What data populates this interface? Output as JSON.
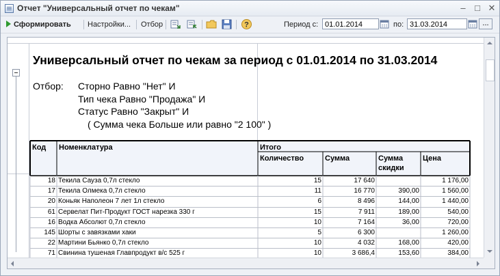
{
  "window": {
    "title": "Отчет \"Универсальный отчет по чекам\"",
    "controls": [
      "–",
      "□",
      "✕"
    ]
  },
  "toolbar": {
    "generate_label": "Сформировать",
    "settings_label": "Настройки...",
    "filter_label": "Отбор",
    "help_label": "?",
    "period_from_label": "Период с:",
    "period_from_value": "01.01.2014",
    "period_to_label": "по:",
    "period_to_value": "31.03.2014",
    "more_label": "..."
  },
  "report": {
    "title": "Универсальный отчет по чекам за период с 01.01.2014 по 31.03.2014",
    "filter_label": "Отбор:",
    "filter_lines": [
      "Сторно Равно \"Нет\" И",
      "Тип чека Равно \"Продажа\" И",
      "Статус Равно \"Закрыт\" И",
      "( Сумма чека Больше или равно \"2 100\" )"
    ],
    "headers": {
      "code": "Код",
      "item": "Номенклатура",
      "total": "Итого",
      "qty": "Количество",
      "sum": "Сумма",
      "discount_line1": "Сумма",
      "discount_line2": "скидки",
      "price": "Цена"
    },
    "rows": [
      {
        "code": "18",
        "item": "Текила Сауза 0,7л стекло",
        "qty": "15",
        "sum": "17 640",
        "discount": "",
        "price": "1 176,00"
      },
      {
        "code": "17",
        "item": "Текила Олмека 0,7л стекло",
        "qty": "11",
        "sum": "16 770",
        "discount": "390,00",
        "price": "1 560,00"
      },
      {
        "code": "20",
        "item": "Коньяк Наполеон 7 лет 1л стекло",
        "qty": "6",
        "sum": "8 496",
        "discount": "144,00",
        "price": "1 440,00"
      },
      {
        "code": "61",
        "item": "Сервелат Пит-Продукт ГОСТ нарезка 330 г",
        "qty": "15",
        "sum": "7 911",
        "discount": "189,00",
        "price": "540,00"
      },
      {
        "code": "16",
        "item": "Водка Абсолют 0,7л стекло",
        "qty": "10",
        "sum": "7 164",
        "discount": "36,00",
        "price": "720,00"
      },
      {
        "code": "145",
        "item": "Шорты с завязками хаки",
        "qty": "5",
        "sum": "6 300",
        "discount": "",
        "price": "1 260,00"
      },
      {
        "code": "22",
        "item": "Мартини Бьянко 0,7л стекло",
        "qty": "10",
        "sum": "4 032",
        "discount": "168,00",
        "price": "420,00"
      },
      {
        "code": "71",
        "item": "Свинина тушеная Главпродукт в/с 525 г",
        "qty": "10",
        "sum": "3 686,4",
        "discount": "153,60",
        "price": "384,00"
      }
    ]
  },
  "colors": {
    "accent_green": "#2f9a2f",
    "header_bg": "#f1f4fa",
    "border": "#a7b0bf"
  }
}
